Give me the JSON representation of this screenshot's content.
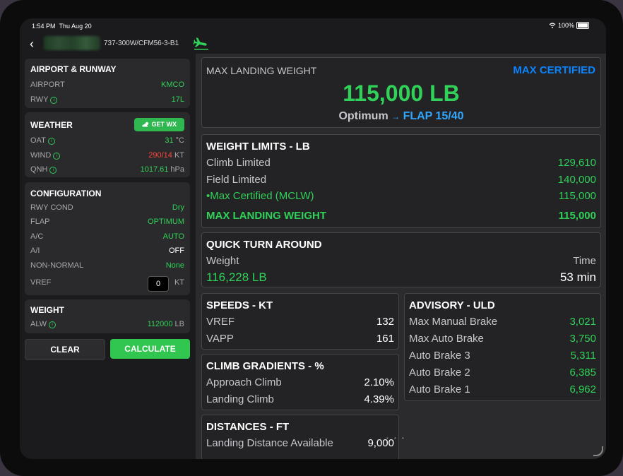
{
  "status_bar": {
    "time": "1:54 PM",
    "date": "Thu Aug 20",
    "battery": "100%"
  },
  "nav": {
    "aircraft": "737-300W/CFM56-3-B1",
    "icons": [
      "back-chevron-icon",
      "landing-plane-icon"
    ]
  },
  "airport": {
    "title": "AIRPORT & RUNWAY",
    "airport_label": "AIRPORT",
    "airport_value": "KMCO",
    "rwy_label": "RWY",
    "rwy_value": "17L"
  },
  "weather": {
    "title": "WEATHER",
    "get_wx": "GET WX",
    "oat_label": "OAT",
    "oat_value": "31",
    "oat_unit": "°C",
    "wind_label": "WIND",
    "wind_value": "290/14",
    "wind_unit": "KT",
    "qnh_label": "QNH",
    "qnh_value": "1017.61",
    "qnh_unit": "hPa"
  },
  "configuration": {
    "title": "CONFIGURATION",
    "rwy_cond_label": "RWY COND",
    "rwy_cond_value": "Dry",
    "flap_label": "FLAP",
    "flap_value": "OPTIMUM",
    "ac_label": "A/C",
    "ac_value": "AUTO",
    "ai_label": "A/I",
    "ai_value": "OFF",
    "nonnormal_label": "NON-NORMAL",
    "nonnormal_value": "None",
    "vref_label": "VREF",
    "vref_value": "0",
    "vref_unit": "KT"
  },
  "weight": {
    "title": "WEIGHT",
    "alw_label": "ALW",
    "alw_value": "112000",
    "alw_unit": "LB"
  },
  "buttons": {
    "clear": "CLEAR",
    "calculate": "CALCULATE"
  },
  "summary": {
    "label": "MAX LANDING WEIGHT",
    "badge": "MAX CERTIFIED",
    "value": "115,000 LB",
    "optimum_label": "Optimum",
    "arrow": "→",
    "flap": "FLAP 15/40"
  },
  "weight_limits": {
    "title": "WEIGHT LIMITS - LB",
    "rows": [
      {
        "label": "Climb Limited",
        "value": "129,610"
      },
      {
        "label": "Field Limited",
        "value": "140,000"
      },
      {
        "label": "•Max Certified (MCLW)",
        "value": "115,000"
      }
    ],
    "total_label": "MAX LANDING WEIGHT",
    "total_value": "115,000"
  },
  "quick_turn": {
    "title": "QUICK TURN AROUND",
    "weight_label": "Weight",
    "time_label": "Time",
    "weight_value": "116,228 LB",
    "time_value": "53 min"
  },
  "speeds": {
    "title": "SPEEDS - KT",
    "rows": [
      {
        "label": "VREF",
        "value": "132"
      },
      {
        "label": "VAPP",
        "value": "161"
      }
    ]
  },
  "advisory": {
    "title": "ADVISORY - ULD",
    "rows": [
      {
        "label": "Max Manual Brake",
        "value": "3,021"
      },
      {
        "label": "Max Auto Brake",
        "value": "3,750"
      },
      {
        "label": "Auto Brake 3",
        "value": "5,311"
      },
      {
        "label": "Auto Brake 2",
        "value": "6,385"
      },
      {
        "label": "Auto Brake 1",
        "value": "6,962"
      }
    ]
  },
  "climb": {
    "title": "CLIMB GRADIENTS - %",
    "rows": [
      {
        "label": "Approach Climb",
        "value": "2.10%"
      },
      {
        "label": "Landing Climb",
        "value": "4.39%"
      }
    ]
  },
  "distances": {
    "title": "DISTANCES - FT",
    "rows": [
      {
        "label": "Landing Distance Available",
        "value": "9,000"
      }
    ]
  },
  "colors": {
    "green": "#30d158",
    "blue": "#0a84ff",
    "red": "#ff453a"
  }
}
